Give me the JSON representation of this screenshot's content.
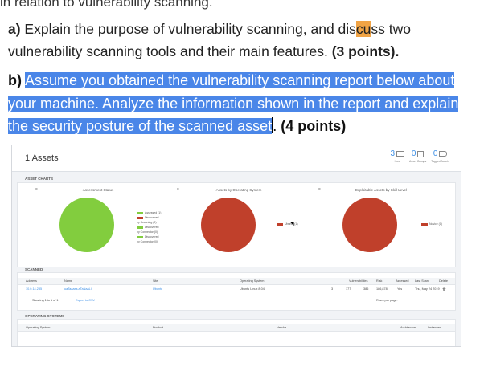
{
  "cutoff_line": "in relation to vulnerability scanning.",
  "question_a": {
    "label": "a)",
    "text_before": " Explain the purpose of vulnerability scanning, and dis",
    "text_highlight": "cu",
    "text_after": "ss two vulnerability scanning tools and their main features. ",
    "points": "(3 points)."
  },
  "question_b": {
    "label": "b)",
    "text_selected": "Assume you obtained the vulnerability scanning report below about your machine. Analyze the information shown in the report and explain the security posture of the scanned asset",
    "text_after": ". ",
    "points": "(4 points)"
  },
  "colors": {
    "selection": "#4a86e8",
    "highlight": "#f1a445",
    "accent": "#3a8ee6",
    "pie_green": "#82cd3e",
    "pie_red": "#c0402b"
  },
  "report": {
    "title": "1 Assets",
    "counters": [
      {
        "value": "3",
        "icon": "monitor-icon",
        "label": "Host"
      },
      {
        "value": "0",
        "icon": "group-icon",
        "label": "Asset Groups"
      },
      {
        "value": "0",
        "icon": "tag-icon",
        "label": "Tagged Assets"
      }
    ],
    "asset_charts_label": "ASSET CHARTS",
    "charts": [
      {
        "title": "Assessment Status",
        "legend": [
          "Assessed (1)",
          "Discovered by Scanning (0)",
          "Discovered by Connector (0)",
          "Discovered by Connector (0)"
        ]
      },
      {
        "title": "Assets by Operating System",
        "legend": [
          "Ubuntu (1)"
        ]
      },
      {
        "title": "Exploitable Assets by Skill Level",
        "legend": [
          "Novice (1)"
        ]
      }
    ],
    "scanned_label": "SCANNED",
    "table_headers": [
      "Address",
      "Name",
      "Site",
      "Operating System",
      "Vulnerabilities",
      "Risk",
      "Assessed",
      "Last Scan",
      "Delete"
    ],
    "table_row": {
      "address": "10.0.14.235",
      "name": "uaTaaaes.aTaNaaLl",
      "site": "Ubuntu",
      "os": "Ubuntu Linux 8.04",
      "crit": "3",
      "vulns": "177",
      "risk": "386",
      "score": "186,878",
      "assessed": "Yes",
      "last_scan": "Thu, May 24 2019"
    },
    "footer_text": "Showing 1 to 1 of 1",
    "export_text": "Export to CSV",
    "rows_per_page": "Rows per page:",
    "os_label": "OPERATING SYSTEMS",
    "os_headers": [
      "Operating System",
      "Product",
      "Vendor",
      "Architecture",
      "Instances"
    ]
  }
}
